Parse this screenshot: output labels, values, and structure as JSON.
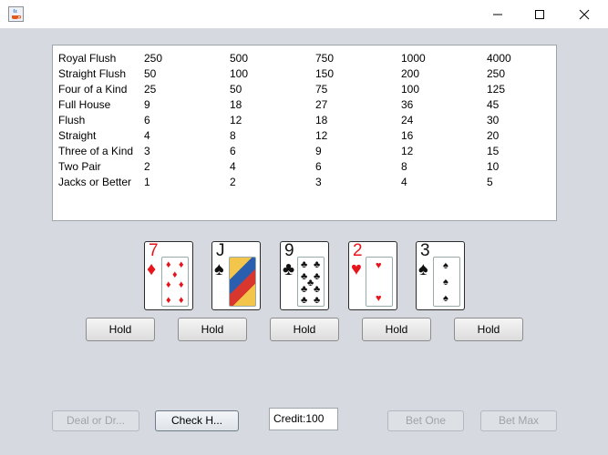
{
  "window": {
    "icon": "java-cup-icon",
    "controls": [
      "minimize-icon",
      "maximize-icon",
      "close-icon"
    ]
  },
  "paytable": {
    "rows": [
      {
        "hand": "Royal Flush",
        "payouts": [
          "250",
          "500",
          "750",
          "1000",
          "4000"
        ]
      },
      {
        "hand": "Straight Flush",
        "payouts": [
          "50",
          "100",
          "150",
          "200",
          "250"
        ]
      },
      {
        "hand": "Four of a Kind",
        "payouts": [
          "25",
          "50",
          "75",
          "100",
          "125"
        ]
      },
      {
        "hand": "Full House",
        "payouts": [
          "9",
          "18",
          "27",
          "36",
          "45"
        ]
      },
      {
        "hand": "Flush",
        "payouts": [
          "6",
          "12",
          "18",
          "24",
          "30"
        ]
      },
      {
        "hand": "Straight",
        "payouts": [
          "4",
          "8",
          "12",
          "16",
          "20"
        ]
      },
      {
        "hand": "Three of a Kind",
        "payouts": [
          "3",
          "6",
          "9",
          "12",
          "15"
        ]
      },
      {
        "hand": "Two Pair",
        "payouts": [
          "2",
          "4",
          "6",
          "8",
          "10"
        ]
      },
      {
        "hand": "Jacks or Better",
        "payouts": [
          "1",
          "2",
          "3",
          "4",
          "5"
        ]
      }
    ]
  },
  "cards": [
    {
      "rank": "7",
      "suit": "♦",
      "color": "red"
    },
    {
      "rank": "J",
      "suit": "♠",
      "color": "black"
    },
    {
      "rank": "9",
      "suit": "♣",
      "color": "black"
    },
    {
      "rank": "2",
      "suit": "♥",
      "color": "red"
    },
    {
      "rank": "3",
      "suit": "♠",
      "color": "black"
    }
  ],
  "hold_label": "Hold",
  "controls": {
    "deal_label": "Deal or Dr...",
    "check_label": "Check H...",
    "credit": "Credit:100",
    "bet_one_label": "Bet One",
    "bet_max_label": "Bet Max"
  },
  "colors": {
    "red_suit": "#e8141b",
    "black_suit": "#111111",
    "background": "#d6d9df"
  }
}
